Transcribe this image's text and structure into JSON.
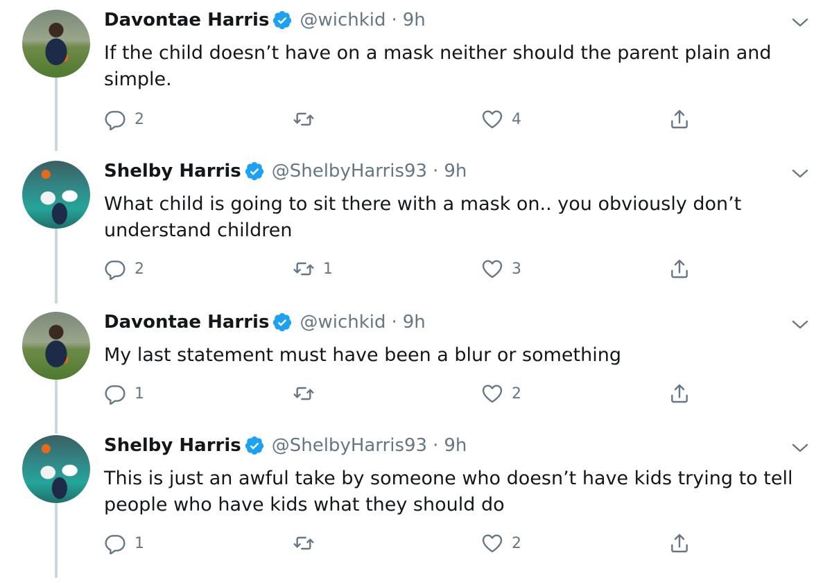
{
  "colors": {
    "accent": "#1da1f2",
    "muted": "#657786",
    "text": "#14171a",
    "thread": "#ccd6dd"
  },
  "tweets": [
    {
      "name": "Davontae Harris",
      "handle": "@wichkid",
      "dot": "·",
      "time": "9h",
      "text": "If the child doesn’t have on a mask neither should the parent plain and simple.",
      "replies": "2",
      "retweets": "",
      "likes": "4"
    },
    {
      "name": "Shelby Harris",
      "handle": "@ShelbyHarris93",
      "dot": "·",
      "time": "9h",
      "text": "What child is going to sit there with a mask on.. you obviously don’t understand children",
      "replies": "2",
      "retweets": "1",
      "likes": "3"
    },
    {
      "name": "Davontae Harris",
      "handle": "@wichkid",
      "dot": "·",
      "time": "9h",
      "text": "My last statement must have been a blur or something",
      "replies": "1",
      "retweets": "",
      "likes": "2"
    },
    {
      "name": "Shelby Harris",
      "handle": "@ShelbyHarris93",
      "dot": "·",
      "time": "9h",
      "text": "This is just an awful take by someone who doesn’t have kids trying to tell people who have kids what they should do",
      "replies": "1",
      "retweets": "",
      "likes": "2"
    }
  ]
}
